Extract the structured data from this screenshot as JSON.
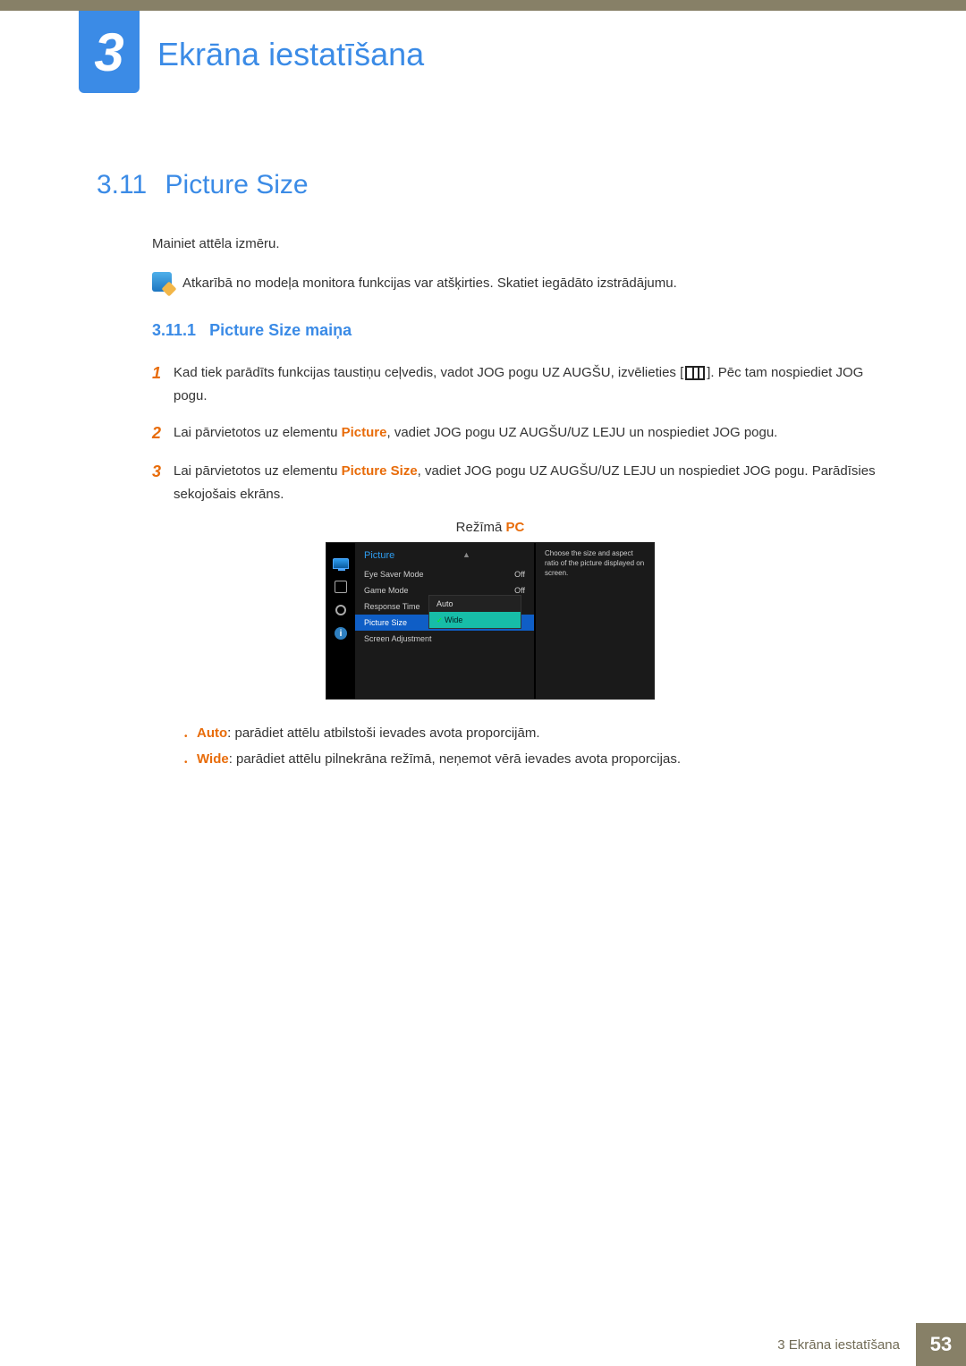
{
  "chapter": {
    "number": "3",
    "title": "Ekrāna iestatīšana"
  },
  "section": {
    "number": "3.11",
    "title": "Picture Size"
  },
  "intro": "Mainiet attēla izmēru.",
  "note": "Atkarībā no modeļa monitora funkcijas var atšķirties. Skatiet iegādāto izstrādājumu.",
  "subsection": {
    "number": "3.11.1",
    "title": "Picture Size maiņa"
  },
  "steps": {
    "s1a": "Kad tiek parādīts funkcijas taustiņu ceļvedis, vadot JOG pogu UZ AUGŠU, izvēlieties [",
    "s1b": "]. Pēc tam nospiediet JOG pogu.",
    "s2a": "Lai pārvietotos uz elementu ",
    "s2_key": "Picture",
    "s2b": ", vadiet JOG pogu UZ AUGŠU/UZ LEJU un nospiediet JOG pogu.",
    "s3a": "Lai pārvietotos uz elementu ",
    "s3_key": "Picture Size",
    "s3b": ", vadiet JOG pogu UZ AUGŠU/UZ LEJU un nospiediet JOG pogu. Parādīsies sekojošais ekrāns."
  },
  "mode": {
    "label": "Režīmā ",
    "value": "PC"
  },
  "osd": {
    "header": "Picture",
    "arrow": "▲",
    "rows": [
      {
        "label": "Eye Saver Mode",
        "value": "Off"
      },
      {
        "label": "Game Mode",
        "value": "Off"
      },
      {
        "label": "Response Time",
        "value": ""
      },
      {
        "label": "Picture Size",
        "value": ""
      },
      {
        "label": "Screen Adjustment",
        "value": ""
      }
    ],
    "popup": {
      "opt1": "Auto",
      "opt2": "Wide"
    },
    "desc": "Choose the size and aspect ratio of the picture displayed on screen."
  },
  "bullets": {
    "b1_key": "Auto",
    "b1": ": parādiet attēlu atbilstoši ievades avota proporcijām.",
    "b2_key": "Wide",
    "b2": ": parādiet attēlu pilnekrāna režīmā, neņemot vērā ievades avota proporcijas."
  },
  "footer": {
    "text": "3 Ekrāna iestatīšana",
    "page": "53"
  }
}
